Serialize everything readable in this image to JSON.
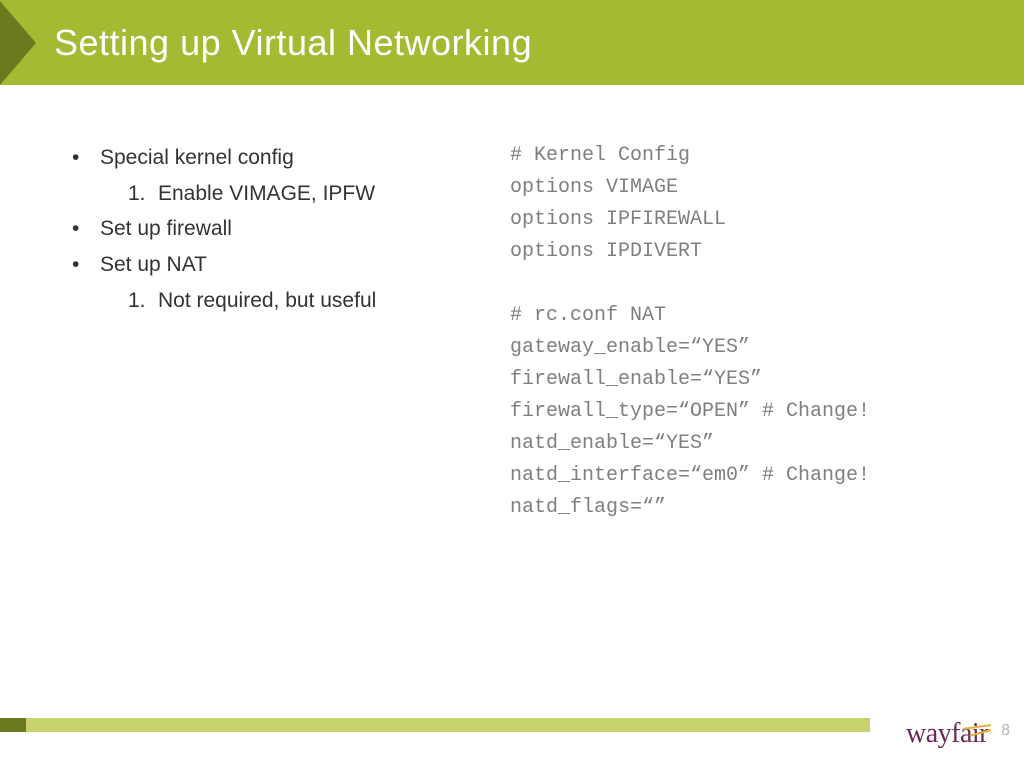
{
  "title": "Setting up Virtual Networking",
  "bullets": {
    "b1": "Special kernel config",
    "b1_1_num": "1.",
    "b1_1": "Enable VIMAGE, IPFW",
    "b2": "Set up firewall",
    "b3": "Set up NAT",
    "b3_1_num": "1.",
    "b3_1": "Not required, but useful"
  },
  "code": {
    "l1": "# Kernel Config",
    "l2": "options VIMAGE",
    "l3": "options IPFIREWALL",
    "l4": "options IPDIVERT",
    "l5": "",
    "l6": "# rc.conf NAT",
    "l7": "gateway_enable=“YES”",
    "l8": "firewall_enable=“YES”",
    "l9": "firewall_type=“OPEN” # Change!",
    "l10": "natd_enable=“YES”",
    "l11": "natd_interface=“em0” # Change!",
    "l12": "natd_flags=“”"
  },
  "page_number": "8",
  "logo_text": "wayfair"
}
